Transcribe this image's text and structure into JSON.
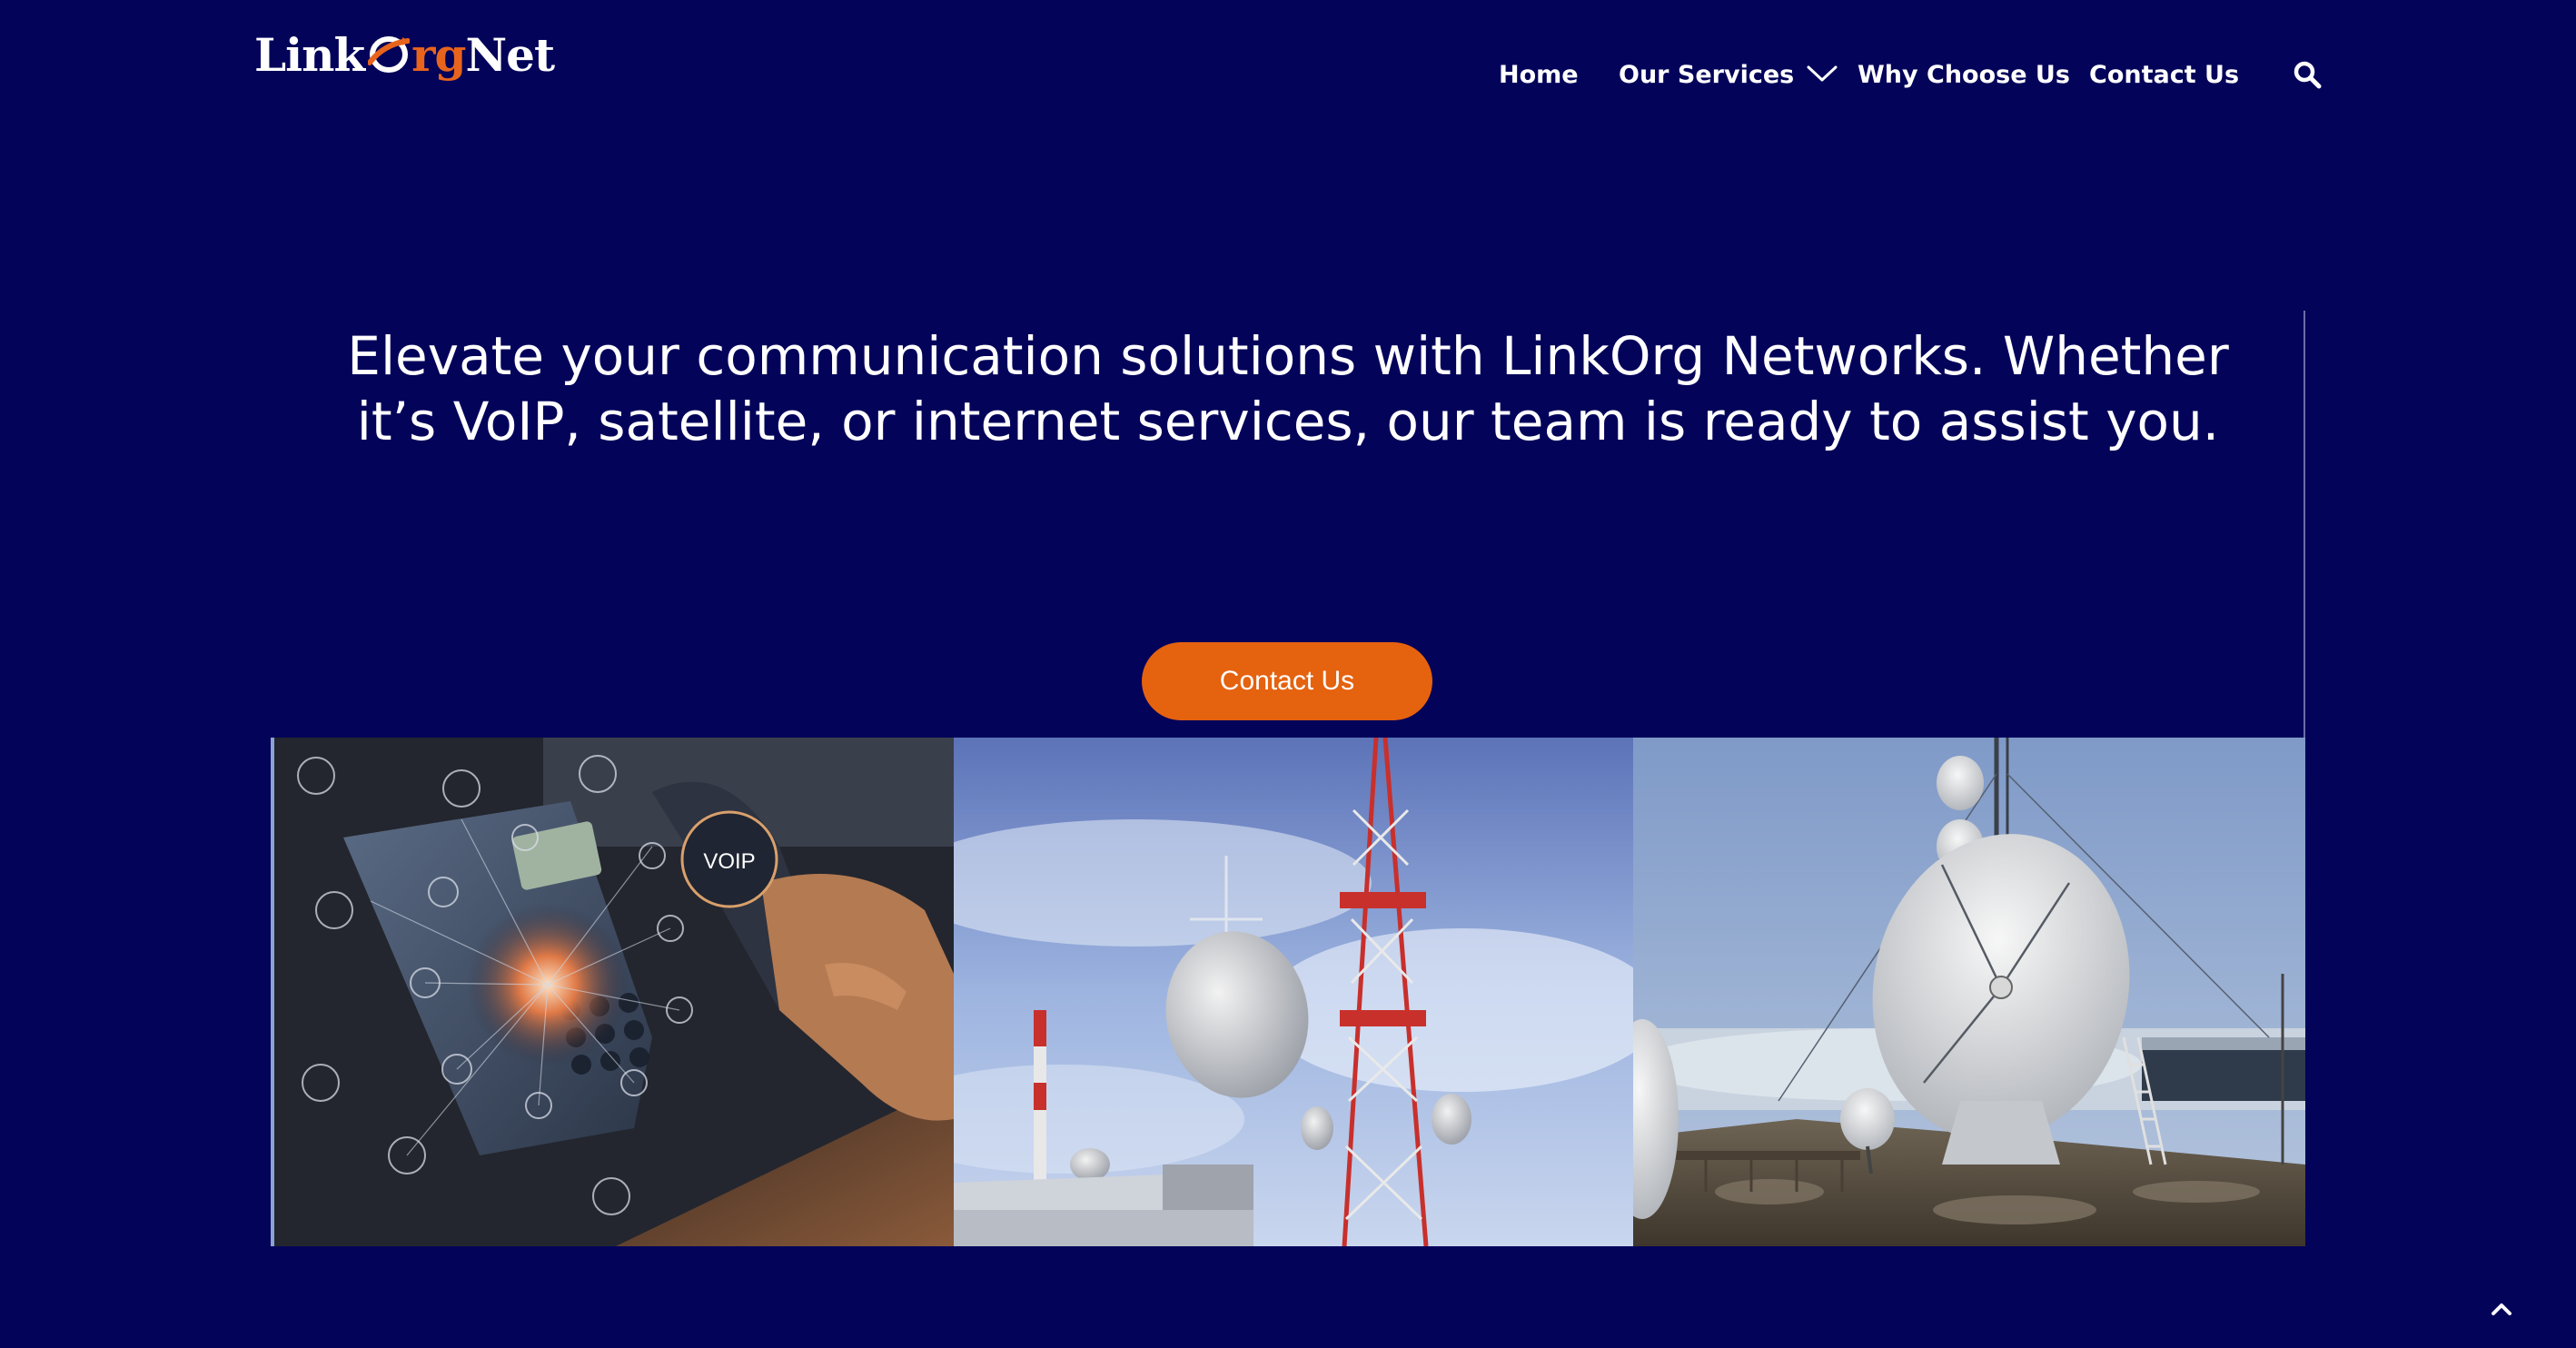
{
  "header": {
    "logo": {
      "part_before": "Link",
      "orange_part": "rg",
      "part_after": "Net",
      "icon": "orbit-o-swirl-icon"
    },
    "nav": {
      "items": [
        {
          "label": "Home"
        },
        {
          "label": "Our Services",
          "has_dropdown": true,
          "dropdown_icon": "chevron-down-icon"
        },
        {
          "label": "Why Choose Us"
        },
        {
          "label": "Contact Us"
        }
      ],
      "search_icon": "search-icon"
    }
  },
  "hero": {
    "line1": "Elevate your communication solutions with LinkOrg Networks. Whether",
    "line2": "it’s VoIP, satellite, or internet services, our team is ready to assist you.",
    "cta_label": "Contact Us"
  },
  "gallery": {
    "tiles": [
      {
        "subject": "voip-desk-phone",
        "badge": "VOIP"
      },
      {
        "subject": "telecom-towers-with-dish"
      },
      {
        "subject": "satellite-ground-station-dishes"
      }
    ]
  },
  "scroll_top_icon": "chevron-up-icon",
  "colors": {
    "background": "#03035a",
    "accent": "#e5620f",
    "text": "#ffffff"
  }
}
